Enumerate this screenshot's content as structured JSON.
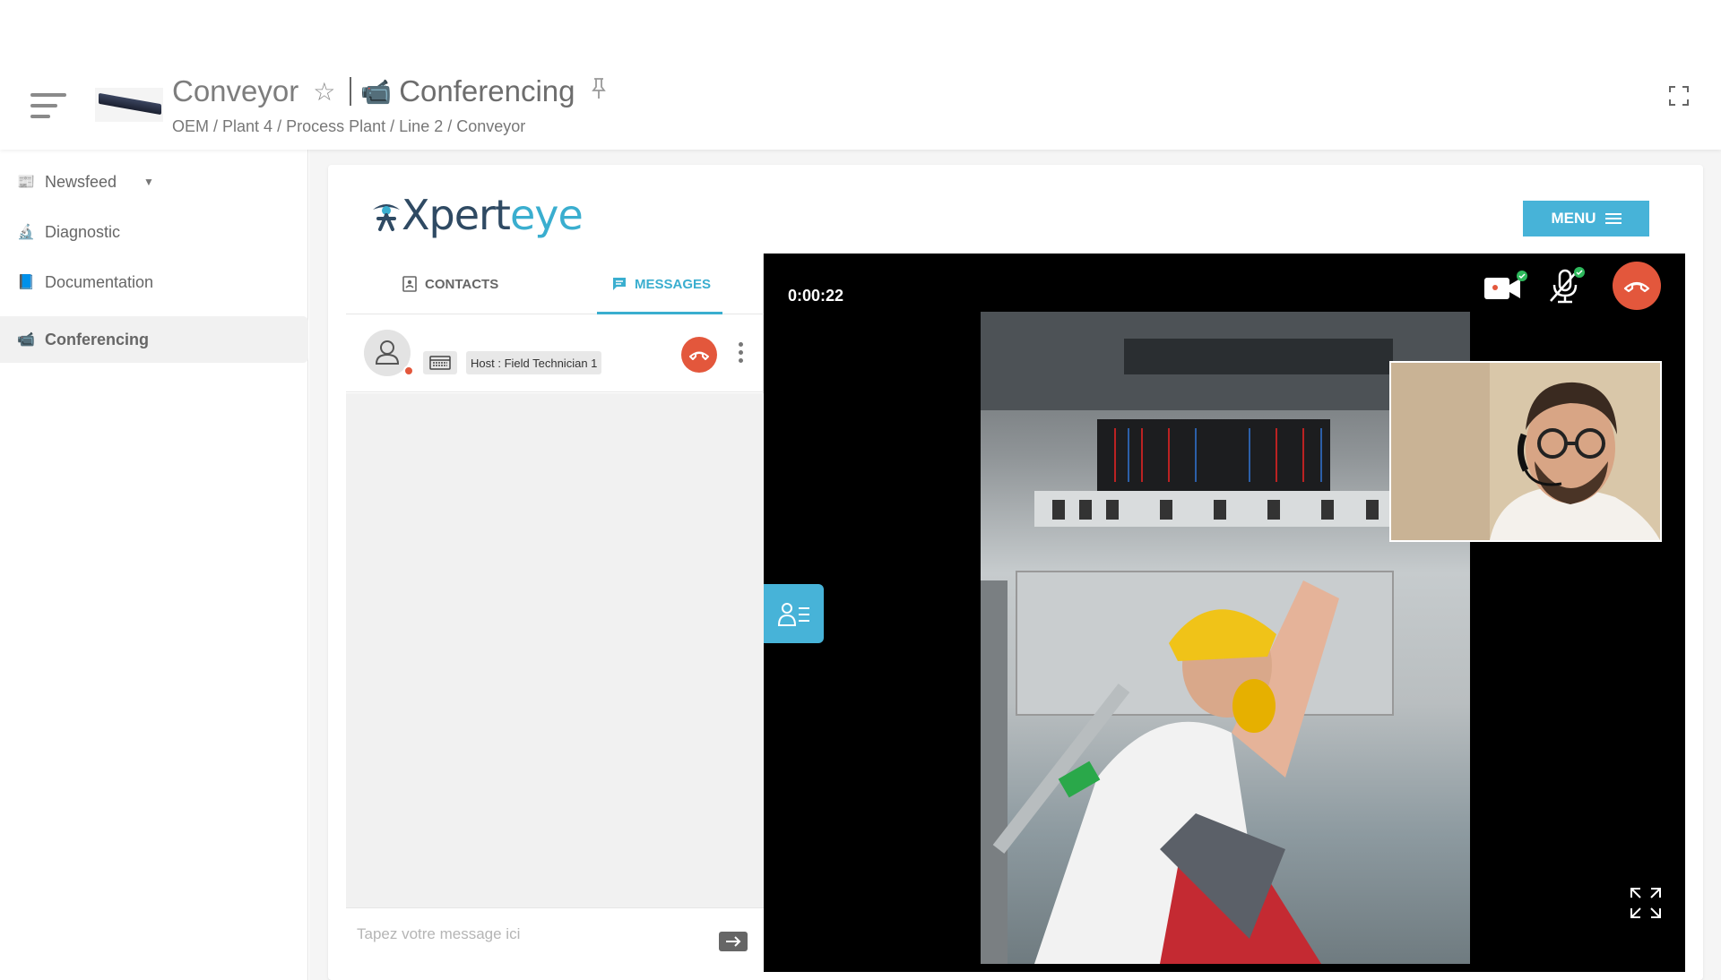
{
  "header": {
    "asset_title": "Conveyor",
    "page_title": "Conferencing",
    "breadcrumb": [
      "OEM",
      "Plant 4",
      "Process Plant",
      "Line 2",
      "Conveyor"
    ],
    "breadcrumb_sep": " / "
  },
  "sidebar": {
    "items": [
      {
        "label": "Newsfeed",
        "icon": "newspaper-icon"
      },
      {
        "label": "Diagnostic",
        "icon": "microscope-icon"
      },
      {
        "label": "Documentation",
        "icon": "book-icon"
      },
      {
        "label": "Conferencing",
        "icon": "video-camera-icon",
        "active": true
      }
    ]
  },
  "app": {
    "logo_part1": "Xpert",
    "logo_part2": "eye",
    "menu_label": "MENU"
  },
  "tabs": {
    "contacts": "CONTACTS",
    "messages": "MESSAGES",
    "active": "messages"
  },
  "contact": {
    "host_label": "Host : Field Technician 1",
    "status": "busy"
  },
  "chat": {
    "placeholder": "Tapez votre message ici"
  },
  "call": {
    "timer": "0:00:22",
    "camera_on": true,
    "mic_on": true
  },
  "colors": {
    "accent": "#47b3d8",
    "hangup": "#e3573c",
    "logo_dark": "#2f4a63",
    "logo_light": "#3aaecf"
  }
}
